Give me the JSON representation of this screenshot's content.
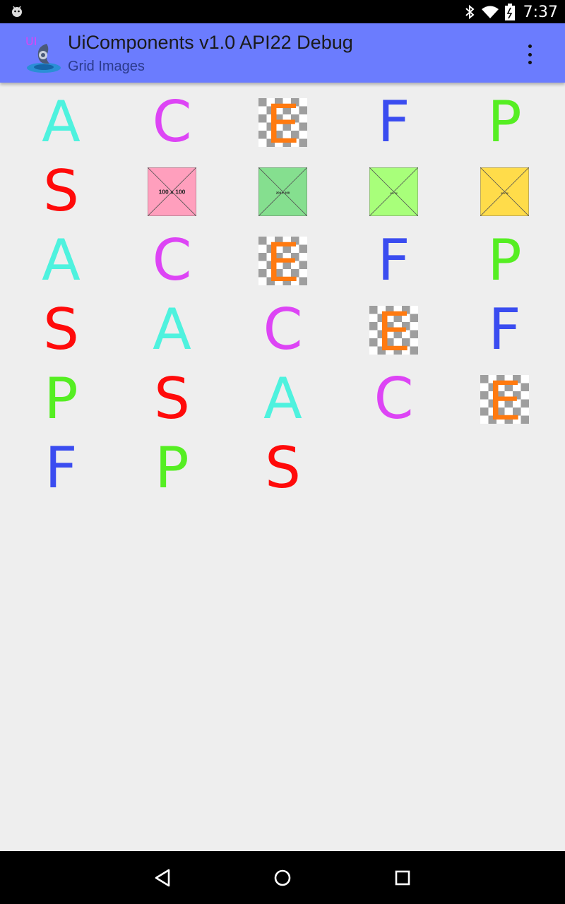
{
  "status_bar": {
    "time": "7:37",
    "icons": [
      "android-icon",
      "bluetooth-icon",
      "wifi-icon",
      "battery-icon"
    ]
  },
  "app_bar": {
    "title": "UiComponents v1.0 API22 Debug",
    "subtitle": "Grid Images",
    "icon_text": "UI",
    "color": "#6b7cfe"
  },
  "grid": {
    "columns": 5,
    "items": [
      {
        "kind": "letter",
        "text": "A",
        "color": "#4ef2de"
      },
      {
        "kind": "letter",
        "text": "C",
        "color": "#dd44f5"
      },
      {
        "kind": "checker",
        "text": "E",
        "color": "#ff7a10"
      },
      {
        "kind": "letter",
        "text": "F",
        "color": "#3a4cf0"
      },
      {
        "kind": "letter",
        "text": "P",
        "color": "#55ee22"
      },
      {
        "kind": "letter",
        "text": "S",
        "color": "#ff0a0a"
      },
      {
        "kind": "placeholder",
        "text": "100 x 100",
        "bg": "#ff9fbd"
      },
      {
        "kind": "placeholder",
        "text": "200 x 200",
        "bg": "#85df8f"
      },
      {
        "kind": "placeholder",
        "text": "400 x 400",
        "bg": "#a8ff7a"
      },
      {
        "kind": "placeholder",
        "text": "800 x 800",
        "bg": "#ffdc4a"
      },
      {
        "kind": "letter",
        "text": "A",
        "color": "#4ef2de"
      },
      {
        "kind": "letter",
        "text": "C",
        "color": "#dd44f5"
      },
      {
        "kind": "checker",
        "text": "E",
        "color": "#ff7a10"
      },
      {
        "kind": "letter",
        "text": "F",
        "color": "#3a4cf0"
      },
      {
        "kind": "letter",
        "text": "P",
        "color": "#55ee22"
      },
      {
        "kind": "letter",
        "text": "S",
        "color": "#ff0a0a"
      },
      {
        "kind": "letter",
        "text": "A",
        "color": "#4ef2de"
      },
      {
        "kind": "letter",
        "text": "C",
        "color": "#dd44f5"
      },
      {
        "kind": "checker",
        "text": "E",
        "color": "#ff7a10"
      },
      {
        "kind": "letter",
        "text": "F",
        "color": "#3a4cf0"
      },
      {
        "kind": "letter",
        "text": "P",
        "color": "#55ee22"
      },
      {
        "kind": "letter",
        "text": "S",
        "color": "#ff0a0a"
      },
      {
        "kind": "letter",
        "text": "A",
        "color": "#4ef2de"
      },
      {
        "kind": "letter",
        "text": "C",
        "color": "#dd44f5"
      },
      {
        "kind": "checker",
        "text": "E",
        "color": "#ff7a10"
      },
      {
        "kind": "letter",
        "text": "F",
        "color": "#3a4cf0"
      },
      {
        "kind": "letter",
        "text": "P",
        "color": "#55ee22"
      },
      {
        "kind": "letter",
        "text": "S",
        "color": "#ff0a0a"
      }
    ]
  },
  "nav_bar": {
    "buttons": [
      "back-icon",
      "home-icon",
      "recents-icon"
    ]
  }
}
